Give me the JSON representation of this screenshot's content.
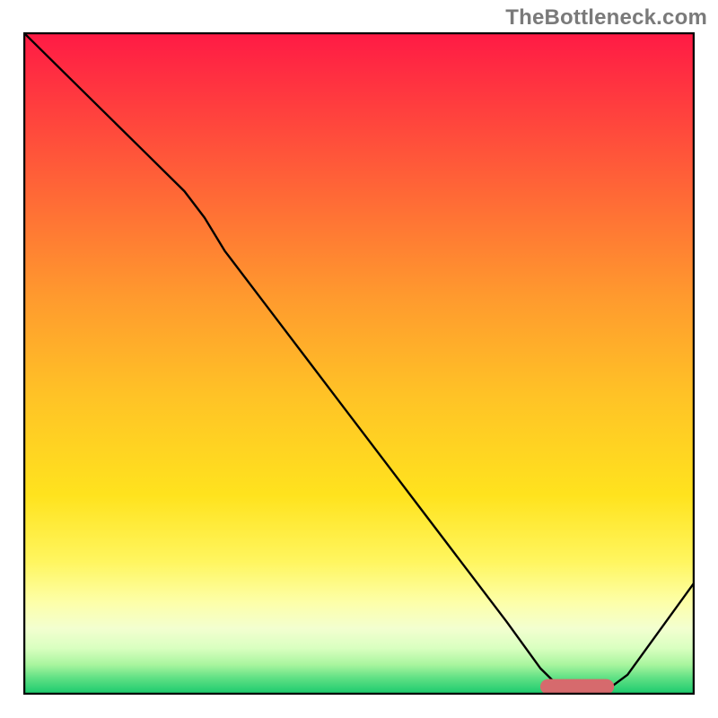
{
  "watermark": "TheBottleneck.com",
  "chart_data": {
    "type": "line",
    "title": "",
    "xlabel": "",
    "ylabel": "",
    "xlim": [
      0,
      100
    ],
    "ylim": [
      0,
      100
    ],
    "grid": false,
    "legend": false,
    "annotations": [],
    "series": [
      {
        "name": "curve",
        "color": "#000000",
        "x": [
          0,
          6,
          12,
          18,
          24,
          27,
          30,
          36,
          42,
          48,
          54,
          60,
          66,
          72,
          77,
          80,
          83,
          86,
          90,
          95,
          100
        ],
        "y": [
          100,
          94,
          88,
          82,
          76,
          72,
          67,
          59,
          51,
          43,
          35,
          27,
          19,
          11,
          4,
          1,
          0,
          0,
          3,
          10,
          17
        ]
      }
    ],
    "marker": {
      "name": "optimum-band",
      "shape": "rounded-bar",
      "color": "#d66a6d",
      "x_range": [
        77,
        88
      ],
      "y": 1.2,
      "height": 2.3
    },
    "background_gradient": {
      "type": "vertical",
      "stops": [
        {
          "pos": 0.0,
          "color": "#ff1a45"
        },
        {
          "pos": 0.1,
          "color": "#ff3a3f"
        },
        {
          "pos": 0.25,
          "color": "#ff6a36"
        },
        {
          "pos": 0.4,
          "color": "#ff9a2e"
        },
        {
          "pos": 0.55,
          "color": "#ffc326"
        },
        {
          "pos": 0.7,
          "color": "#ffe31e"
        },
        {
          "pos": 0.8,
          "color": "#fff660"
        },
        {
          "pos": 0.86,
          "color": "#fdffa8"
        },
        {
          "pos": 0.9,
          "color": "#f3ffd0"
        },
        {
          "pos": 0.93,
          "color": "#d9ffc0"
        },
        {
          "pos": 0.955,
          "color": "#a8f59e"
        },
        {
          "pos": 0.975,
          "color": "#5fe084"
        },
        {
          "pos": 1.0,
          "color": "#17c96c"
        }
      ]
    }
  }
}
